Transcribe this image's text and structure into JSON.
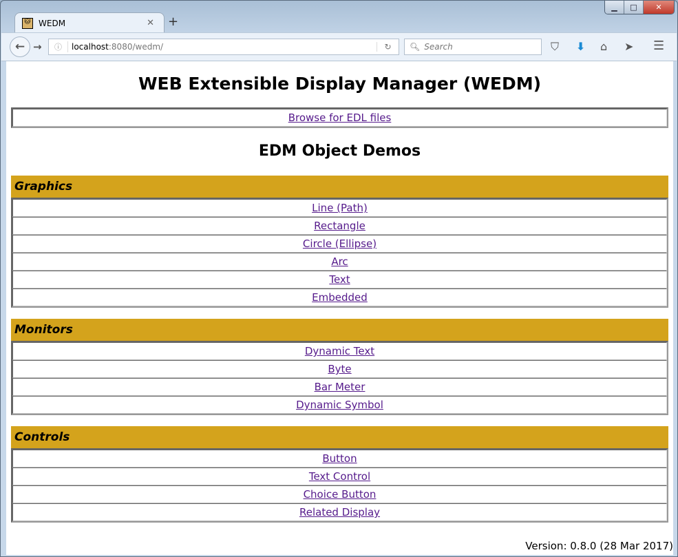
{
  "browser": {
    "tab_title": "WEDM",
    "url_host": "localhost",
    "url_rest": ":8080/wedm/",
    "search_placeholder": "Search",
    "colors": {
      "header": "#D4A31C",
      "link": "#551A8B"
    }
  },
  "page": {
    "title": "WEB Extensible Display Manager (WEDM)",
    "browse_link": "Browse for EDL files",
    "demos_title": "EDM Object Demos",
    "version": "Version: 0.8.0 (28 Mar 2017)"
  },
  "sections": [
    {
      "title": "Graphics",
      "items": [
        "Line (Path)",
        "Rectangle",
        "Circle (Ellipse)",
        "Arc",
        "Text",
        "Embedded"
      ]
    },
    {
      "title": "Monitors",
      "items": [
        "Dynamic Text",
        "Byte",
        "Bar Meter",
        "Dynamic Symbol"
      ]
    },
    {
      "title": "Controls",
      "items": [
        "Button",
        "Text Control",
        "Choice Button",
        "Related Display"
      ]
    }
  ]
}
